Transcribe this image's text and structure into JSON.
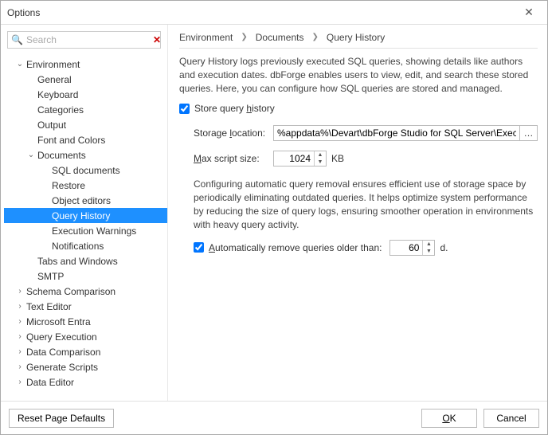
{
  "window": {
    "title": "Options"
  },
  "search": {
    "placeholder": "Search"
  },
  "tree": {
    "environment": "Environment",
    "general": "General",
    "keyboard": "Keyboard",
    "categories": "Categories",
    "output": "Output",
    "fonts": "Font and Colors",
    "documents": "Documents",
    "sqldocs": "SQL documents",
    "restore": "Restore",
    "objeditors": "Object editors",
    "queryhistory": "Query History",
    "execwarn": "Execution Warnings",
    "notifications": "Notifications",
    "tabswin": "Tabs and Windows",
    "smtp": "SMTP",
    "schemacomp": "Schema Comparison",
    "texteditor": "Text Editor",
    "msentra": "Microsoft Entra",
    "queryexec": "Query Execution",
    "datacomp": "Data Comparison",
    "genscripts": "Generate Scripts",
    "dataeditor": "Data Editor"
  },
  "crumbs": {
    "c1": "Environment",
    "c2": "Documents",
    "c3": "Query History"
  },
  "content": {
    "desc": "Query History logs previously executed SQL queries, showing details like authors and execution dates. dbForge enables users to view, edit, and search these stored queries. Here, you can configure how SQL queries are stored and managed.",
    "store_prefix": "Store query ",
    "store_u": "h",
    "store_suffix": "istory",
    "loc_prefix": "Storage ",
    "loc_u": "l",
    "loc_suffix": "ocation:",
    "loc_value": "%appdata%\\Devart\\dbForge Studio for SQL Server\\ExecutedQuerie",
    "max_u": "M",
    "max_suffix": "ax script size:",
    "max_value": "1024",
    "max_unit": "KB",
    "para2": "Configuring automatic query removal ensures efficient use of storage space by periodically eliminating outdated queries. It helps optimize system performance by reducing the size of query logs, ensuring smoother operation in environments with heavy query activity.",
    "auto_u": "A",
    "auto_suffix": "utomatically remove queries older than:",
    "auto_value": "60",
    "auto_unit": "d."
  },
  "footer": {
    "reset": "Reset Page Defaults",
    "ok_u": "O",
    "ok_suffix": "K",
    "cancel": "Cancel"
  }
}
